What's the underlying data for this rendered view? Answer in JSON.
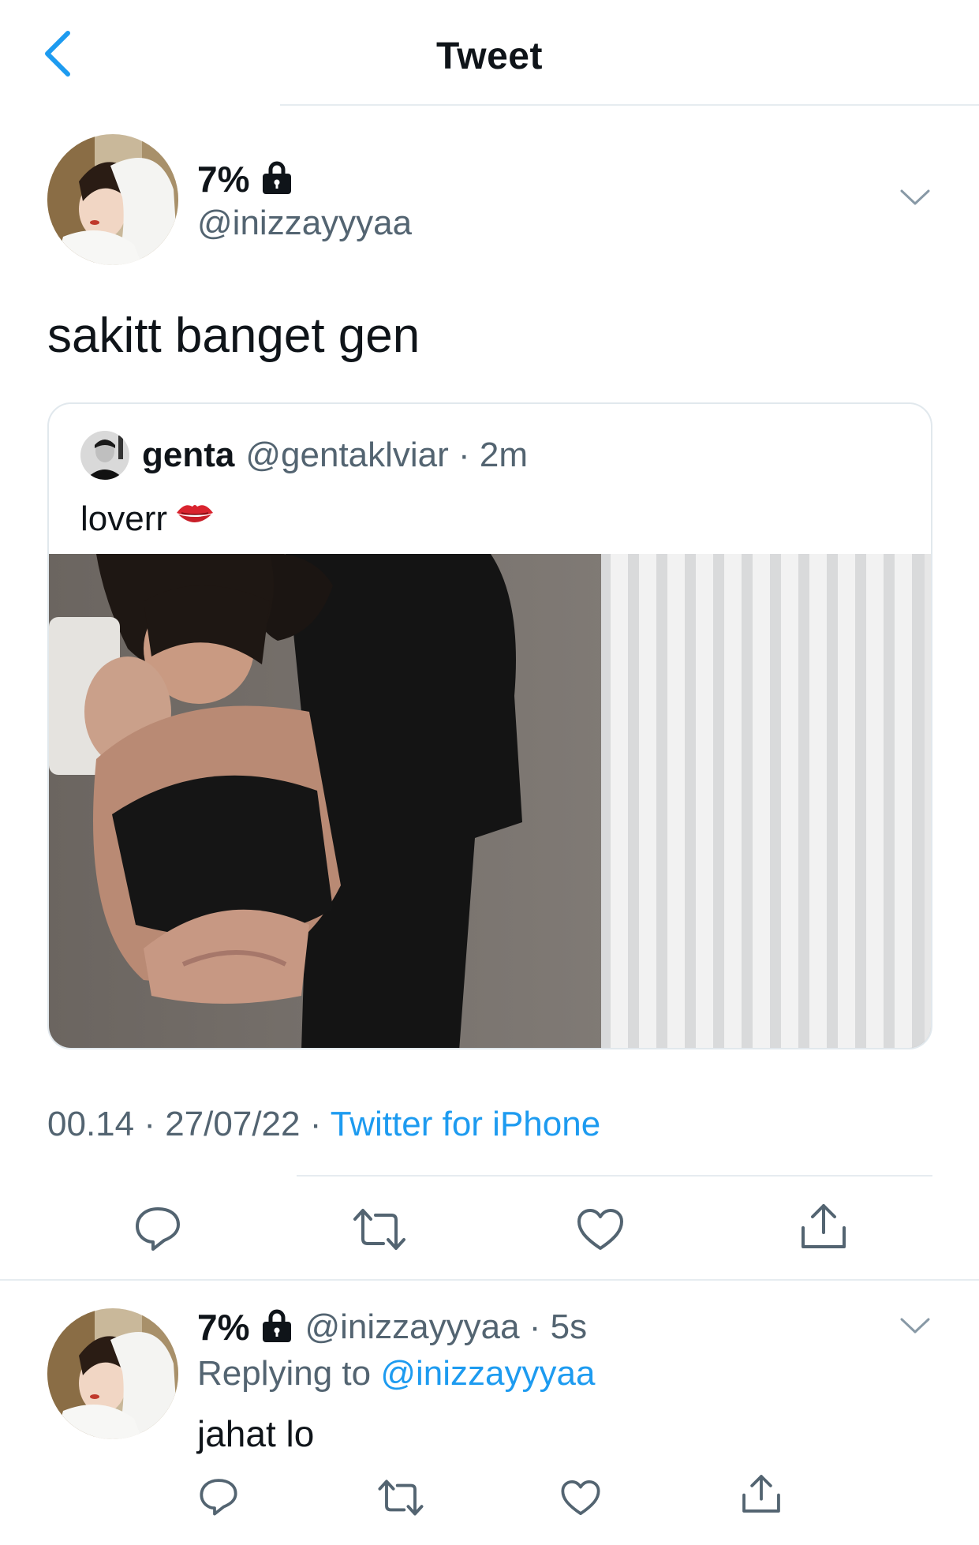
{
  "header": {
    "title": "Tweet"
  },
  "tweet": {
    "display_name": "7%",
    "handle": "@inizzayyyaa",
    "text": "sakitt banget gen",
    "timestamp": "00.14 · 27/07/22 · ",
    "source": "Twitter for iPhone"
  },
  "quoted_tweet": {
    "display_name": "genta",
    "handle_time": "@gentaklviar · 2m",
    "text": "loverr"
  },
  "reply": {
    "display_name": "7%",
    "handle_time": "@inizzayyyaa · 5s",
    "replying_prefix": "Replying to ",
    "replying_to": "@inizzayyyaa",
    "text": "jahat lo"
  },
  "icons": [
    "back-chevron-icon",
    "lock-icon",
    "chevron-down-icon",
    "lips-emoji-icon",
    "reply-icon",
    "retweet-icon",
    "like-icon",
    "share-icon"
  ],
  "colors": {
    "accent": "#1d9bf0",
    "text_primary": "#0f1419",
    "text_secondary": "#536471",
    "divider": "#e6ecf0"
  }
}
